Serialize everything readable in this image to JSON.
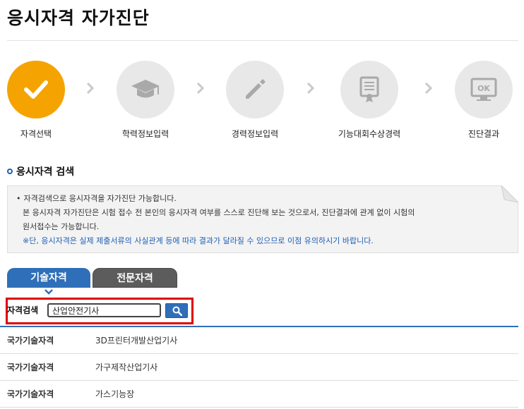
{
  "page": {
    "title": "응시자격 자가진단"
  },
  "steps": [
    {
      "label": "자격선택",
      "icon": "check-icon",
      "active": true
    },
    {
      "label": "학력정보입력",
      "icon": "graduation-cap-icon",
      "active": false
    },
    {
      "label": "경력정보입력",
      "icon": "pencil-icon",
      "active": false
    },
    {
      "label": "기능대회수상경력",
      "icon": "certificate-icon",
      "active": false
    },
    {
      "label": "진단결과",
      "icon": "monitor-ok-icon",
      "active": false,
      "badge": "OK"
    }
  ],
  "section": {
    "title": "응시자격 검색"
  },
  "notice": {
    "line1": "자격검색으로 응시자격을 자가진단 가능합니다.",
    "line2": "본 응시자격 자가진단은 시험 접수 전 본인의 응시자격 여부를 스스로 진단해 보는 것으로서, 진단결과에 관계 없이 시험의",
    "line3": "원서접수는 가능합니다.",
    "line4": "※단, 응시자격은 실제 제출서류의 사실관계 등에 따라 결과가 달라질 수 있으므로 이점 유의하시기 바랍니다."
  },
  "tabs": {
    "technical": "기술자격",
    "professional": "전문자격"
  },
  "search": {
    "label": "자격검색",
    "value": "산업안전기사"
  },
  "results": [
    {
      "category": "국가기술자격",
      "name": "3D프린터개발산업기사"
    },
    {
      "category": "국가기술자격",
      "name": "가구제작산업기사"
    },
    {
      "category": "국가기술자격",
      "name": "가스기능장"
    }
  ],
  "colors": {
    "accent": "#2f6fb9",
    "active_step": "#f5a300",
    "highlight": "#e00000"
  }
}
